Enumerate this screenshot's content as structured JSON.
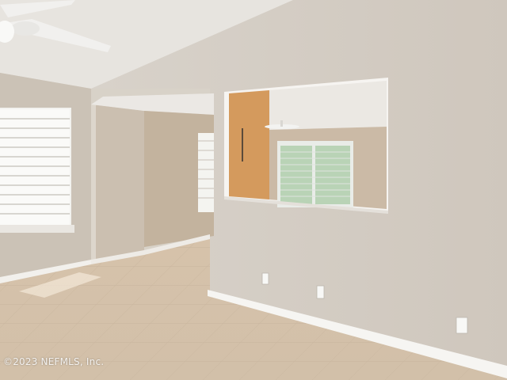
{
  "photo": {
    "watermark": "©2023 NEFMLS, Inc.",
    "colors": {
      "ceiling": "#e6e3de",
      "wall_main": "#d6cfc6",
      "wall_left": "#c9bfb2",
      "wall_hall": "#c2b29e",
      "accent_wall": "#d39a5c",
      "floor": "#d9c6ae",
      "baseboard": "#f3f1ee",
      "window_light": "#f5f5f2"
    }
  }
}
